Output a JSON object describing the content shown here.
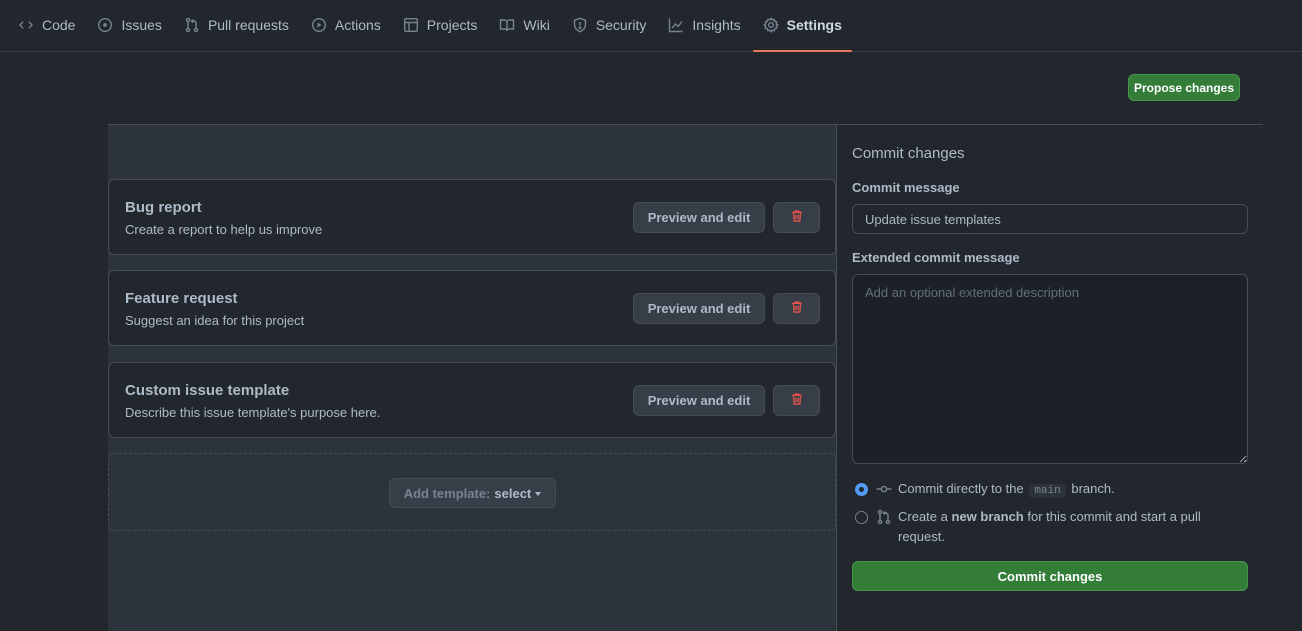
{
  "nav": {
    "tabs": [
      {
        "label": "Code",
        "icon": "code-icon"
      },
      {
        "label": "Issues",
        "icon": "issue-opened-icon"
      },
      {
        "label": "Pull requests",
        "icon": "git-pull-request-icon"
      },
      {
        "label": "Actions",
        "icon": "play-icon"
      },
      {
        "label": "Projects",
        "icon": "table-icon"
      },
      {
        "label": "Wiki",
        "icon": "book-icon"
      },
      {
        "label": "Security",
        "icon": "shield-icon"
      },
      {
        "label": "Insights",
        "icon": "graph-icon"
      },
      {
        "label": "Settings",
        "icon": "gear-icon"
      }
    ],
    "selected": "Settings"
  },
  "toolbar": {
    "propose_label": "Propose changes"
  },
  "templates": [
    {
      "title": "Bug report",
      "description": "Create a report to help us improve",
      "preview_label": "Preview and edit",
      "delete_icon": "trash-icon"
    },
    {
      "title": "Feature request",
      "description": "Suggest an idea for this project",
      "preview_label": "Preview and edit",
      "delete_icon": "trash-icon"
    },
    {
      "title": "Custom issue template",
      "description": "Describe this issue template's purpose here.",
      "preview_label": "Preview and edit",
      "delete_icon": "trash-icon"
    }
  ],
  "add_template": {
    "label": "Add template:",
    "select_label": "select"
  },
  "commit": {
    "heading": "Commit changes",
    "message_label": "Commit message",
    "message_value": "Update issue templates",
    "extended_label": "Extended commit message",
    "extended_placeholder": "Add an optional extended description",
    "option_direct_prefix": "Commit directly to the",
    "option_direct_branch": "main",
    "option_direct_suffix": "branch.",
    "option_new_prefix": "Create a",
    "option_new_bold": "new branch",
    "option_new_suffix": "for this commit and start a pull request.",
    "button_label": "Commit changes"
  },
  "colors": {
    "background": "#22272e",
    "panel": "#2d333b",
    "border": "#444c56",
    "accent_green": "#347d39",
    "danger": "#e5534b",
    "selected_underline": "#ec775c",
    "radio_selected": "#539bf5"
  }
}
